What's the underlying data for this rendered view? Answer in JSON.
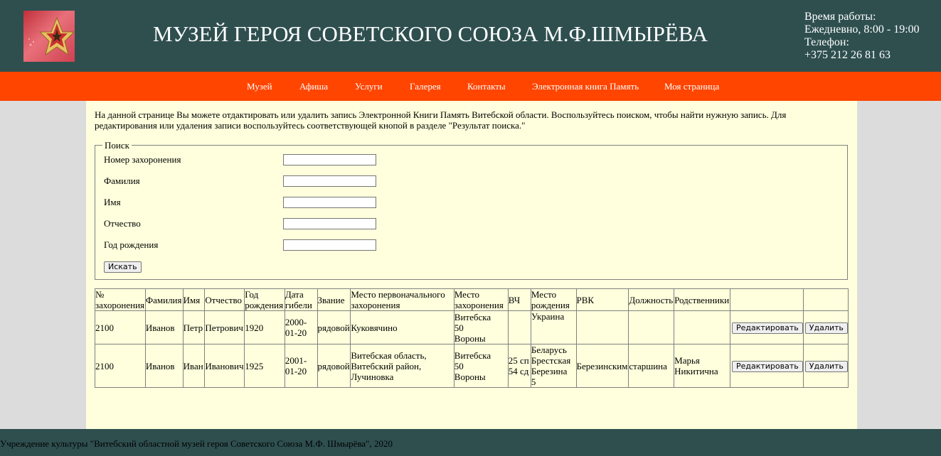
{
  "header": {
    "title": "МУЗЕЙ ГЕРОЯ СОВЕТСКОГО СОЮЗА М.Ф.ШМЫРЁВА",
    "hours_label": "Время работы:",
    "hours_value": "Ежедневно, 8:00 - 19:00",
    "phone_label": "Телефон:",
    "phone_value": "+375 212 26 81 63",
    "logo_icon": "star-medal-icon"
  },
  "nav": {
    "items": [
      {
        "label": "Музей"
      },
      {
        "label": "Афиша"
      },
      {
        "label": "Услуги"
      },
      {
        "label": "Галерея"
      },
      {
        "label": "Контакты"
      },
      {
        "label": "Электронная книга Память"
      },
      {
        "label": "Моя страница"
      }
    ]
  },
  "intro": "На данной странице Вы можете отдактировать или удалить запись Электронной Книги Память Витебской области. Воспользуйтесь поиском, чтобы найти нужную запись. Для редактирования или удаления записи воспользуйтесь соответствующей кнопой в разделе \"Результат поиска.\"",
  "search": {
    "legend": "Поиск",
    "fields": [
      {
        "label": "Номер захоронения",
        "value": ""
      },
      {
        "label": "Фамилия",
        "value": ""
      },
      {
        "label": "Имя",
        "value": ""
      },
      {
        "label": "Отчество",
        "value": ""
      },
      {
        "label": "Год рождения",
        "value": ""
      }
    ],
    "button": "Искать"
  },
  "results": {
    "headers": [
      "№ захоронения",
      "Фамилия",
      "Имя",
      "Отчество",
      "Год рождения",
      "Дата гибели",
      "Звание",
      "Место первоначального захоронения",
      "Место захоронения",
      "ВЧ",
      "Место рождения",
      "РВК",
      "Должность",
      "Родственники",
      "",
      ""
    ],
    "rows": [
      {
        "burial_no": "2100",
        "surname": "Иванов",
        "name": "Петр",
        "patronymic": "Петрович",
        "birth_year": "1920",
        "death_date": "2000-01-20",
        "rank": "рядовой",
        "original_burial": "Куковячино",
        "burial_place": [
          "Витебска",
          "50",
          "Вороны"
        ],
        "unit": [],
        "birth_place": [
          "Украина"
        ],
        "rvk": "",
        "position": "",
        "relatives": "",
        "edit_label": "Редактировать",
        "delete_label": "Удалить"
      },
      {
        "burial_no": "2100",
        "surname": "Иванов",
        "name": "Иван",
        "patronymic": "Иванович",
        "birth_year": "1925",
        "death_date": "2001-01-20",
        "rank": "рядовой",
        "original_burial": "Витебская область, Витебский район, Лучиновка",
        "burial_place": [
          "Витебска",
          "50",
          "Вороны"
        ],
        "unit": [
          "25 сп",
          "54 сд"
        ],
        "birth_place": [
          "Беларусь",
          "Брестская",
          "Березина",
          "5"
        ],
        "rvk": "Березинским",
        "position": "старшина",
        "relatives": "Марья Никитична",
        "edit_label": "Редактировать",
        "delete_label": "Удалить"
      }
    ]
  },
  "footer": "Учреждение культуры \"Витебский областной музей героя Советского Союза М.Ф. Шмырёва\", 2020",
  "colors": {
    "header_bg": "#2f4f4f",
    "nav_bg": "#ff4500",
    "content_bg": "#ffffdd",
    "page_bg": "#dcdcdc"
  }
}
